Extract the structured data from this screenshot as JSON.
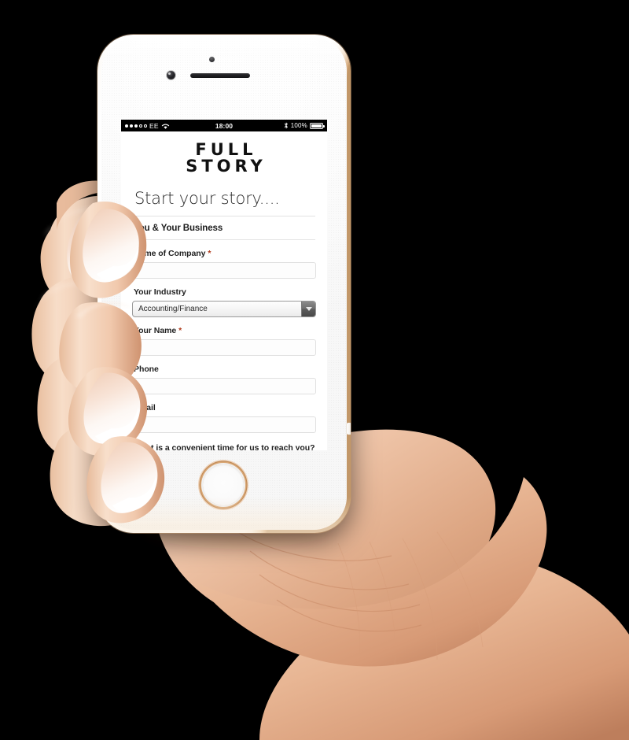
{
  "scene": {
    "background_color": "#000000",
    "description_name": "hand-holding-phone"
  },
  "device": {
    "name": "iphone",
    "finish_color": "#d9b48a",
    "body_color": "#ffffff"
  },
  "status_bar": {
    "signal_dots_filled": 3,
    "signal_dots_total": 5,
    "carrier": "EE",
    "wifi_icon": "wifi-icon",
    "time": "18:00",
    "bluetooth_icon": "bluetooth-icon",
    "battery_percent": "100%",
    "battery_level": 100
  },
  "screen": {
    "logo": {
      "line1": "FULL",
      "line2": "STORY"
    },
    "headline": "Start your story....",
    "section_title": "You & Your Business",
    "fields": [
      {
        "label": "Name of Company",
        "required": true,
        "required_marker": "*",
        "type": "text",
        "value": "",
        "placeholder": ""
      },
      {
        "label": "Your Industry",
        "required": false,
        "required_marker": "",
        "type": "select",
        "value": "Accounting/Finance",
        "placeholder": ""
      },
      {
        "label": "Your Name",
        "required": true,
        "required_marker": "*",
        "type": "text",
        "value": "",
        "placeholder": ""
      },
      {
        "label": "Phone",
        "required": false,
        "required_marker": "",
        "type": "text",
        "value": "",
        "placeholder": ""
      },
      {
        "label": "Email",
        "required": false,
        "required_marker": "",
        "type": "text",
        "value": "",
        "placeholder": ""
      }
    ],
    "question": "What is a convenient time for us to reach you?",
    "required_color": "#b03a1a"
  }
}
